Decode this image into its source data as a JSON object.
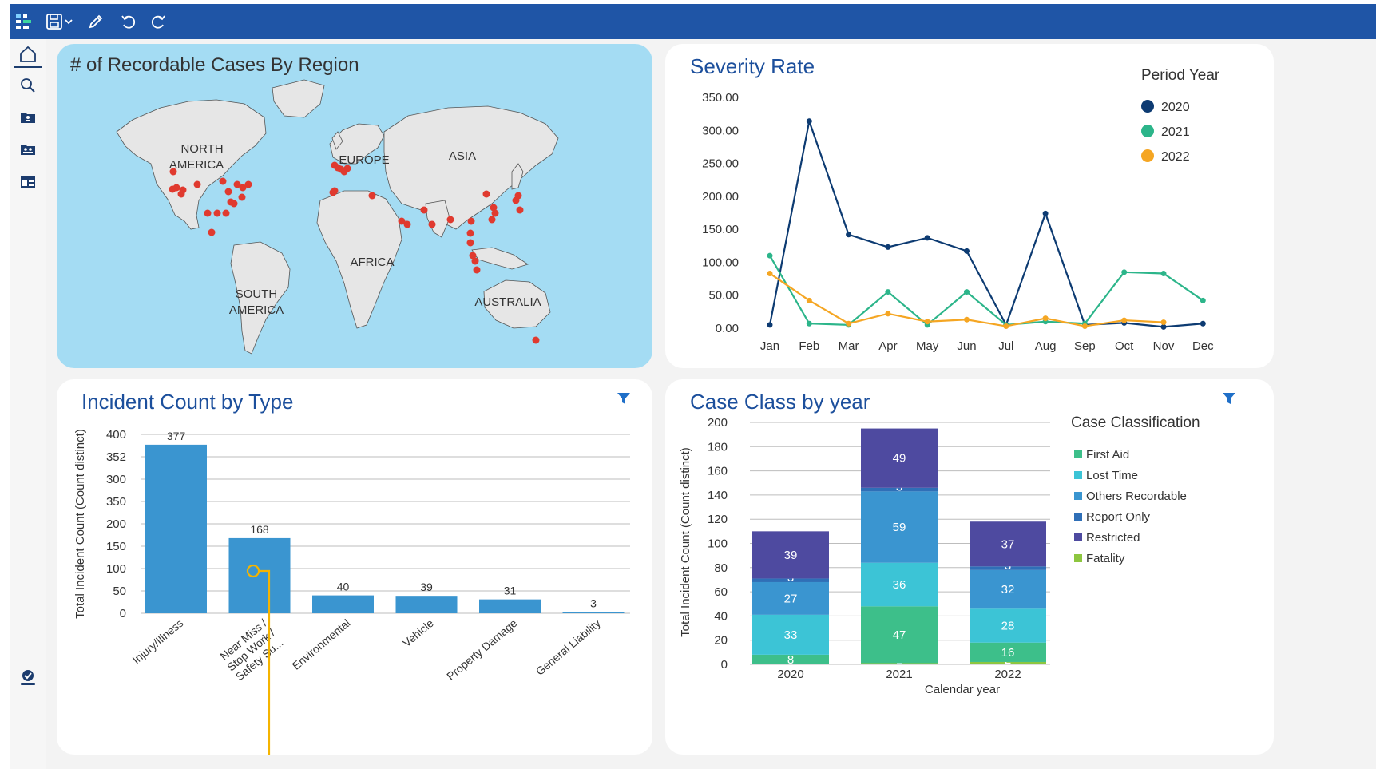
{
  "toolbar": {
    "icons": [
      "app-logo-icon",
      "save-icon",
      "chevron-down-icon",
      "edit-pencil-icon",
      "undo-icon",
      "redo-icon"
    ]
  },
  "sidebar": {
    "icons": [
      "home-icon",
      "search-icon",
      "user-folder-icon",
      "group-folder-icon",
      "table-folder-icon",
      "user-settings-icon"
    ]
  },
  "colors": {
    "topbar": "#1f55a6",
    "title": "#1c4f9c",
    "map_water": "#a4dcf3",
    "map_land": "#e6e6e6",
    "map_marker": "#e03a2f",
    "series_2020": "#0d3b72",
    "series_2021": "#2cb58a",
    "series_2022": "#f5a623",
    "bar": "#3a95d0",
    "cursor": "#f5b400"
  },
  "map_panel": {
    "title": "# of Recordable Cases By Region",
    "regions": [
      "NORTH AMERICA",
      "EUROPE",
      "ASIA",
      "AFRICA",
      "SOUTH AMERICA",
      "AUSTRALIA"
    ]
  },
  "severity_panel": {
    "title": "Severity Rate",
    "legend_title": "Period Year"
  },
  "incident_panel": {
    "title": "Incident Count by Type"
  },
  "caseclass_panel": {
    "title": "Case Class by year",
    "legend_title": "Case Classification"
  },
  "chart_data": [
    {
      "type": "line",
      "title": "Severity Rate",
      "categories": [
        "Jan",
        "Feb",
        "Mar",
        "Apr",
        "May",
        "Jun",
        "Jul",
        "Aug",
        "Sep",
        "Oct",
        "Nov",
        "Dec"
      ],
      "y_ticks": [
        "350.00",
        "300.00",
        "250.00",
        "200.00",
        "150.00",
        "100.00",
        "50.00",
        "0.00"
      ],
      "ylim": [
        0,
        350
      ],
      "legend_title": "Period Year",
      "legend_position": "top-right",
      "series": [
        {
          "name": "2020",
          "color": "#0d3b72",
          "values": [
            5,
            314,
            142,
            123,
            137,
            117,
            5,
            174,
            5,
            8,
            2,
            7
          ]
        },
        {
          "name": "2021",
          "color": "#2cb58a",
          "values": [
            110,
            7,
            5,
            55,
            5,
            55,
            5,
            10,
            7,
            85,
            83,
            42
          ]
        },
        {
          "name": "2022",
          "color": "#f5a623",
          "values": [
            83,
            42,
            7,
            22,
            10,
            13,
            3,
            15,
            3,
            12,
            9,
            null
          ]
        }
      ]
    },
    {
      "type": "bar",
      "title": "Incident Count by Type",
      "ylabel": "Total Incident Count (Count distinct)",
      "categories": [
        "Injury/Illness",
        "Near Miss / Stop Work / Safety Su...",
        "Environmental",
        "Vehicle",
        "Property Damage",
        "General Liability"
      ],
      "values": [
        377,
        168,
        40,
        39,
        31,
        3
      ],
      "y_ticks": [
        "400",
        "352",
        "300",
        "350",
        "200",
        "150",
        "100",
        "50",
        "0"
      ],
      "ylim": [
        0,
        400
      ],
      "grid": true
    },
    {
      "type": "bar",
      "stacked": true,
      "title": "Case Class by year",
      "xlabel": "Calendar year",
      "ylabel": "Total Incident Count (Count distinct)",
      "categories": [
        "2020",
        "2021",
        "2022"
      ],
      "y_ticks": [
        "200",
        "180",
        "160",
        "140",
        "120",
        "100",
        "80",
        "60",
        "40",
        "20",
        "0"
      ],
      "ylim": [
        0,
        200
      ],
      "legend_title": "Case Classification",
      "legend_position": "right",
      "series": [
        {
          "name": "Fatality",
          "color": "#8dc63f",
          "values": [
            0,
            1,
            2
          ]
        },
        {
          "name": "First Aid",
          "color": "#3dbf8a",
          "values": [
            8,
            47,
            16
          ]
        },
        {
          "name": "Lost Time",
          "color": "#3cc4d6",
          "values": [
            33,
            36,
            28
          ]
        },
        {
          "name": "Others Recordable",
          "color": "#3a95d0",
          "values": [
            27,
            59,
            32
          ]
        },
        {
          "name": "Report Only",
          "color": "#2f6fb7",
          "values": [
            3,
            3,
            3
          ]
        },
        {
          "name": "Restricted",
          "color": "#4e4aa0",
          "values": [
            39,
            49,
            37
          ]
        }
      ],
      "legend_order": [
        "First Aid",
        "Lost Time",
        "Others Recordable",
        "Report Only",
        "Restricted",
        "Fatality"
      ]
    }
  ]
}
